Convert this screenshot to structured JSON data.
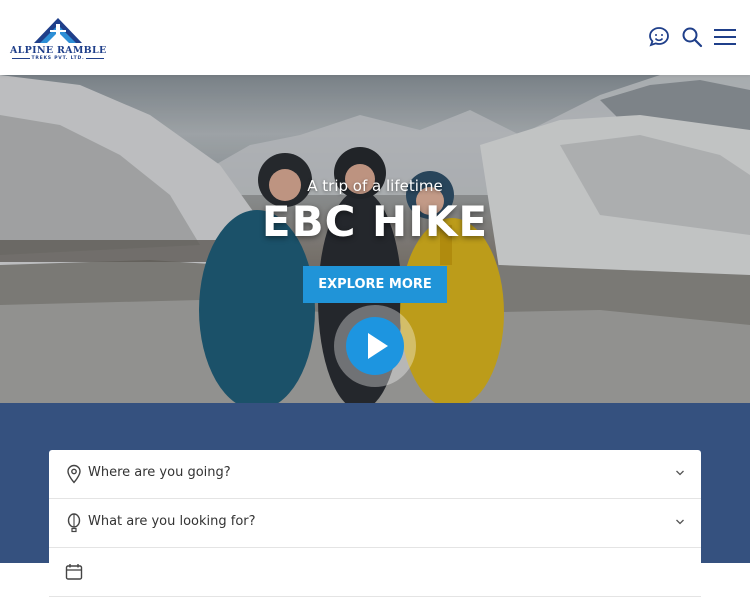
{
  "header": {
    "logo": {
      "brand": "ALPINE RAMBLE",
      "sub": "TREKS PVT. LTD."
    },
    "icons": [
      "chat-icon",
      "search-icon",
      "menu-icon"
    ]
  },
  "hero": {
    "tagline": "A trip of a lifetime",
    "headline": "EBC HIKE",
    "cta_label": "EXPLORE MORE"
  },
  "search": {
    "fields": [
      {
        "label": "Where are you going?",
        "icon": "location-pin-icon"
      },
      {
        "label": "What are you looking for?",
        "icon": "balloon-icon"
      },
      {
        "label": "",
        "icon": "calendar-icon"
      }
    ]
  },
  "colors": {
    "brand": "#1f3f8a",
    "accent": "#2094d8",
    "section_bg": "#35517f"
  }
}
